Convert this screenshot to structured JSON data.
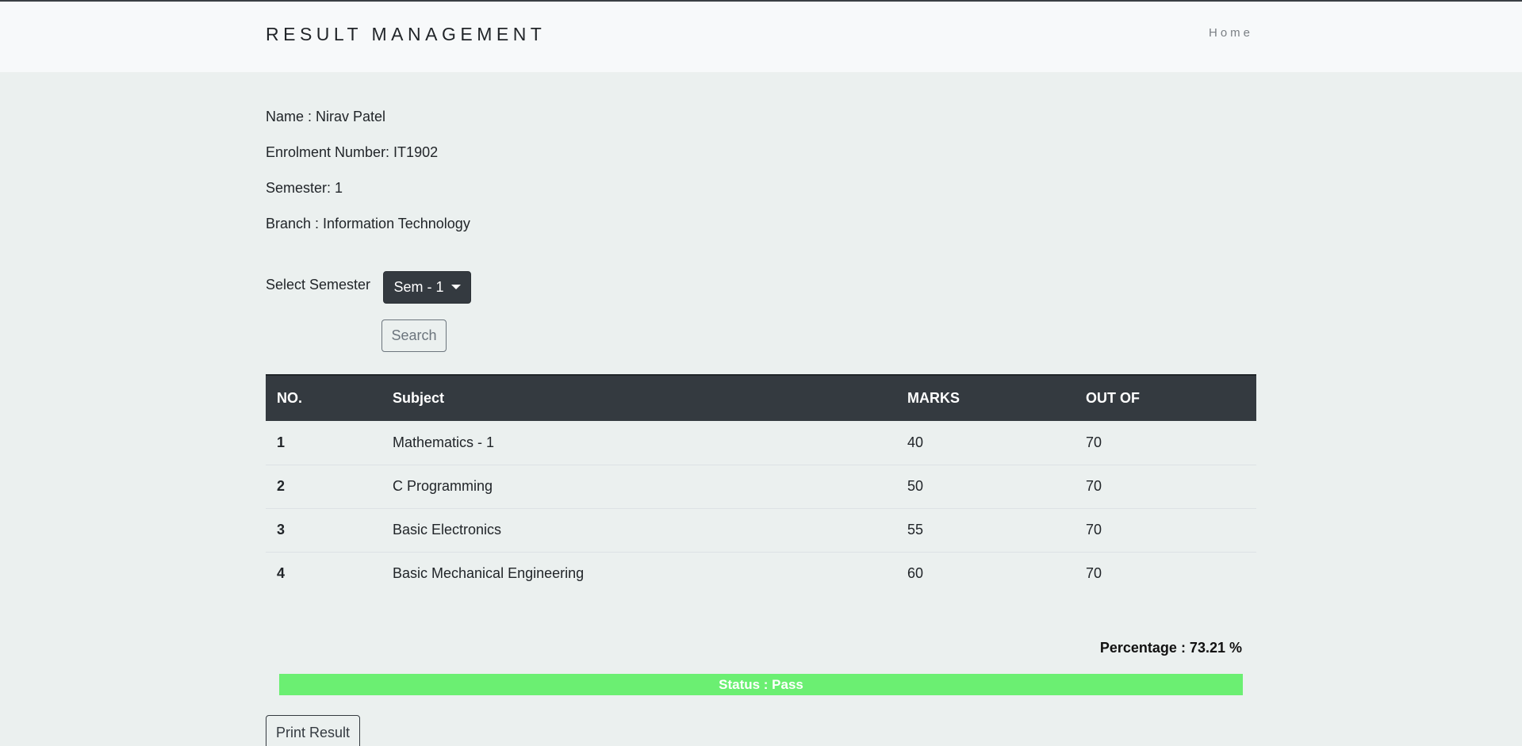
{
  "navbar": {
    "brand": "RESULT MANAGEMENT",
    "home_link": "Home"
  },
  "student": {
    "name": "Name : Nirav Patel",
    "enrolment": "Enrolment Number: IT1902",
    "semester": "Semester: 1",
    "branch": "Branch : Information Technology"
  },
  "controls": {
    "select_label": "Select Semester",
    "semester_selected": "Sem - 1",
    "search_label": "Search"
  },
  "table": {
    "headers": [
      "NO.",
      "Subject",
      "MARKS",
      "OUT OF"
    ],
    "rows": [
      {
        "no": "1",
        "subject": "Mathematics - 1",
        "marks": "40",
        "out_of": "70"
      },
      {
        "no": "2",
        "subject": "C Programming",
        "marks": "50",
        "out_of": "70"
      },
      {
        "no": "3",
        "subject": "Basic Electronics",
        "marks": "55",
        "out_of": "70"
      },
      {
        "no": "4",
        "subject": "Basic Mechanical Engineering",
        "marks": "60",
        "out_of": "70"
      }
    ]
  },
  "summary": {
    "percentage": "Percentage : 73.21 %",
    "status": "Status : Pass",
    "status_color": "#6bef72"
  },
  "actions": {
    "print_label": "Print Result"
  },
  "colors": {
    "header_dark": "#343a40",
    "background": "#ebf0ef"
  }
}
